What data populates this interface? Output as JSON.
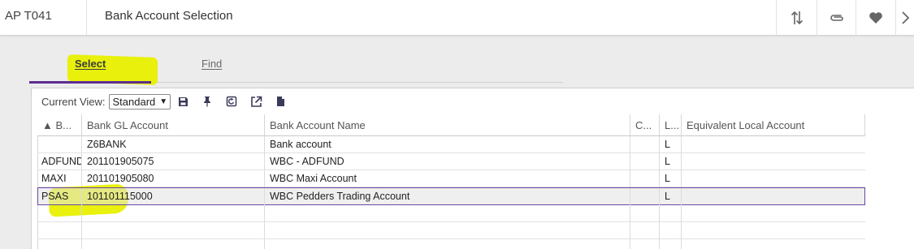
{
  "header": {
    "form_id": "AP T041",
    "title": "Bank Account Selection",
    "icons": [
      "sort-updown-icon",
      "paperclip-icon",
      "heart-icon",
      "chevron-right-icon"
    ]
  },
  "tabs": [
    {
      "label": "Select",
      "active": true
    },
    {
      "label": "Find",
      "active": false
    }
  ],
  "toolbar": {
    "current_view_label": "Current View:",
    "view_value": "Standard",
    "icons": [
      "save-icon",
      "pin-icon",
      "restore-icon",
      "open-external-icon",
      "document-icon"
    ]
  },
  "grid": {
    "columns": [
      "▲ B...",
      "Bank GL Account",
      "Bank Account Name",
      "C...",
      "L...",
      "Equivalent Local Account"
    ],
    "rows": [
      {
        "bank": "",
        "gl": "Z6BANK",
        "name": "Bank account",
        "c": "",
        "l": "L",
        "equiv": ""
      },
      {
        "bank": "ADFUND",
        "gl": "201101905075",
        "name": "WBC - ADFUND",
        "c": "",
        "l": "L",
        "equiv": ""
      },
      {
        "bank": "MAXI",
        "gl": "201101905080",
        "name": "WBC Maxi Account",
        "c": "",
        "l": "L",
        "equiv": ""
      },
      {
        "bank": "PSAS",
        "gl": "101101115000",
        "name": "WBC Pedders Trading Account",
        "c": "",
        "l": "L",
        "equiv": "",
        "selected": true
      },
      {
        "bank": "",
        "gl": "",
        "name": "",
        "c": "",
        "l": "",
        "equiv": ""
      },
      {
        "bank": "",
        "gl": "",
        "name": "",
        "c": "",
        "l": "",
        "equiv": ""
      }
    ]
  },
  "colors": {
    "accent": "#5c2d91",
    "highlight": "#e8f000",
    "selected_row_border": "#6b46a8"
  }
}
